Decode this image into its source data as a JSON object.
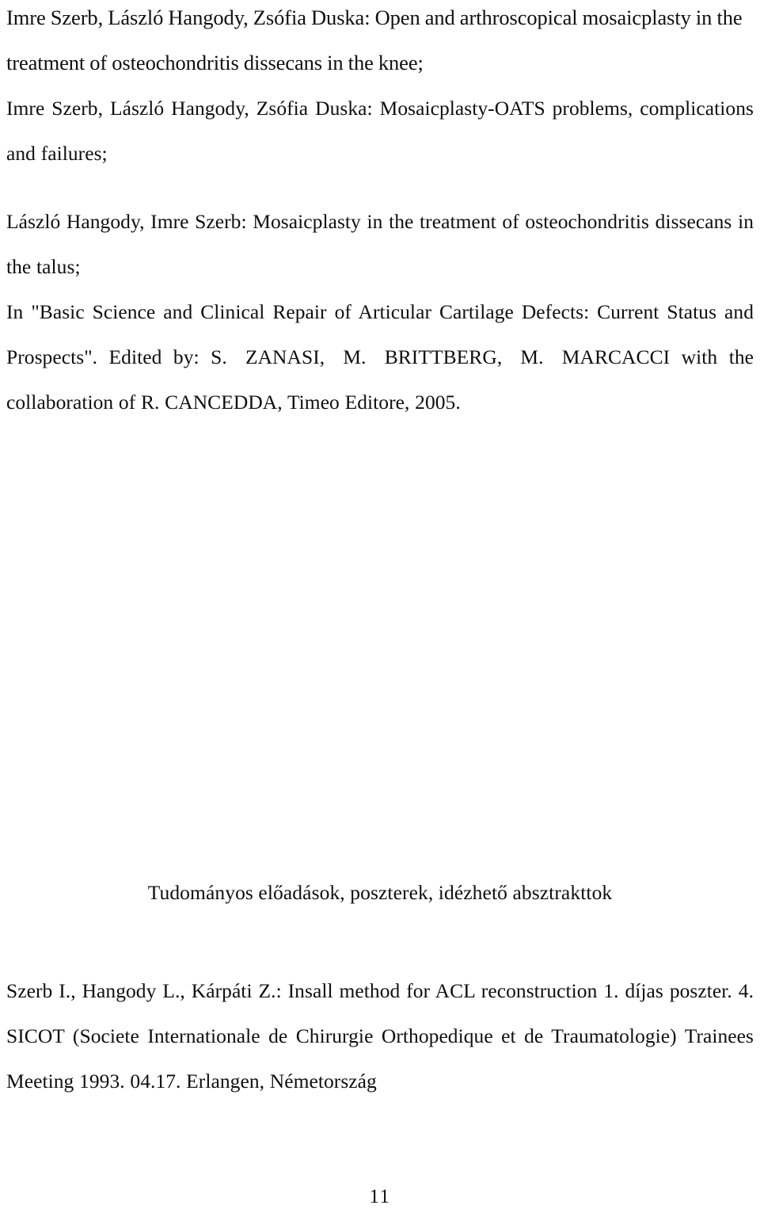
{
  "document": {
    "language": "en-hu",
    "page_number": "11",
    "text_color": "#100f10",
    "background_color": "#ffffff"
  },
  "publications": {
    "entries": [
      {
        "id": "mosaicplasty-knee",
        "text": "Imre Szerb, László Hangody, Zsófia Duska: Open and arthroscopical mosaicplasty in the treatment of osteochondritis dissecans in the knee;"
      },
      {
        "id": "mosaicplasty-oats",
        "text": "Imre Szerb, László Hangody, Zsófia Duska: Mosaicplasty-OATS problems, complications and failures;"
      },
      {
        "id": "mosaicplasty-talus",
        "text": "László Hangody, Imre Szerb: Mosaicplasty in the treatment of osteochondritis dissecans in the talus;"
      },
      {
        "id": "book-chapter-source",
        "text_part1": "In \"Basic Science and Clinical Repair of Articular Cartilage Defects: Current Status and Prospects\". Edited by:",
        "editors": "S. ZANASI,  M. BRITTBERG,  M. MARCACCI",
        "text_part2": "with the collaboration of R. CANCEDDA, Timeo Editore, 2005."
      }
    ]
  },
  "section": {
    "heading": "Tudományos előadások, poszterek, idézhető absztrakttok"
  },
  "presentations": {
    "entries": [
      {
        "id": "insall-acl-poster",
        "text": "Szerb I., Hangody L., Kárpáti Z.: Insall method for ACL reconstruction 1. díjas poszter. 4. SICOT (Societe Internationale de Chirurgie Orthopedique et de Traumatologie) Trainees Meeting 1993. 04.17. Erlangen, Németország"
      }
    ]
  },
  "footer": {
    "page_number": "11"
  }
}
